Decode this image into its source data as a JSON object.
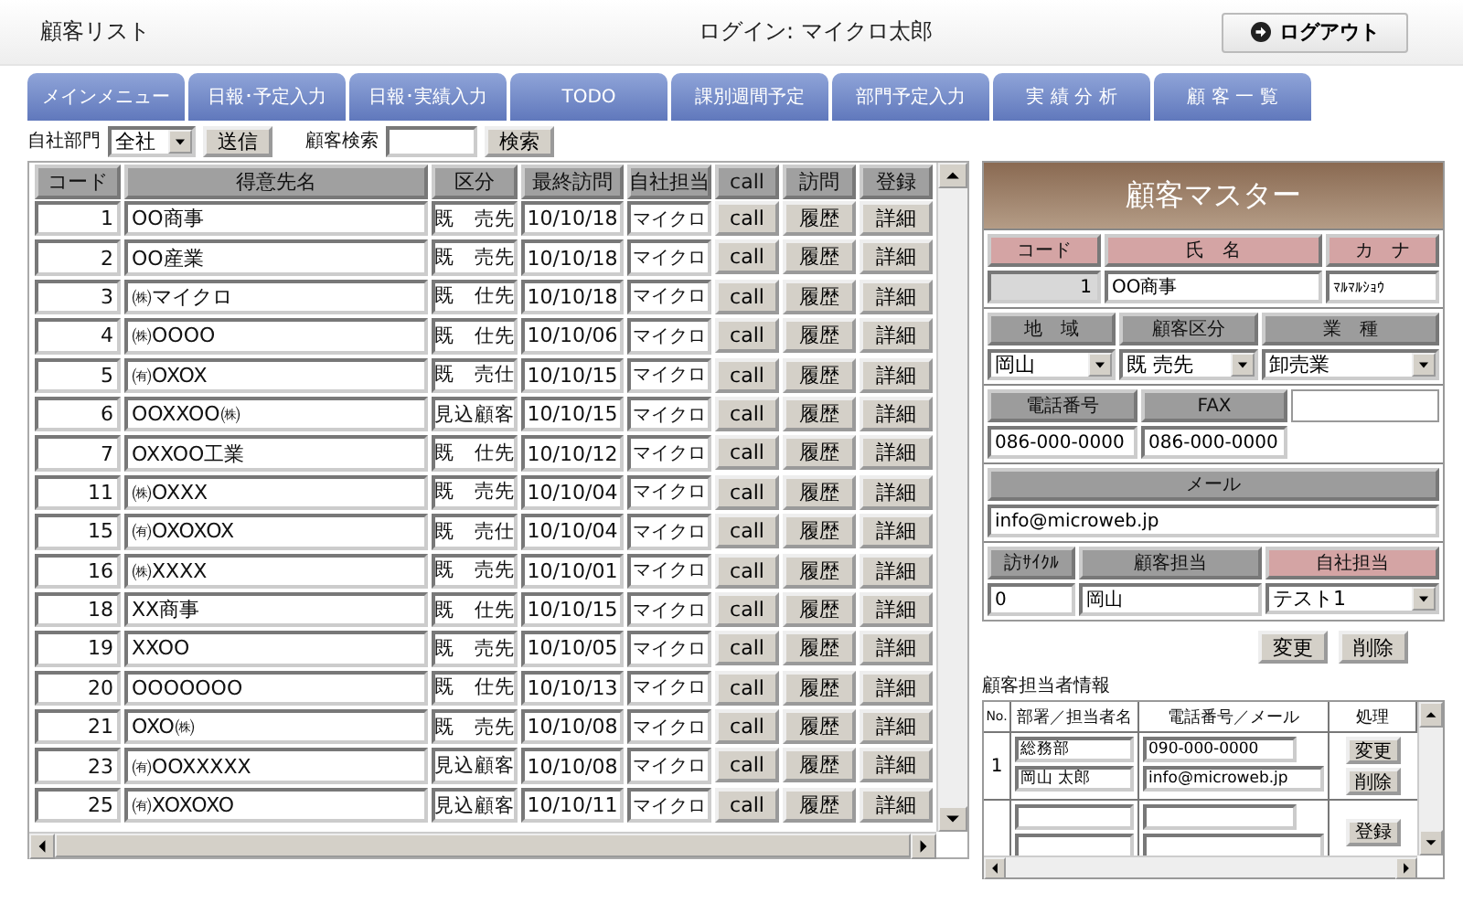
{
  "header": {
    "title": "顧客リスト",
    "login": "ログイン: マイクロ太郎",
    "logout": "ログアウト"
  },
  "tabs": [
    {
      "label": "メインメニュー",
      "selected": false
    },
    {
      "label": "日報･予定入力",
      "selected": false
    },
    {
      "label": "日報･実績入力",
      "selected": false
    },
    {
      "label": "TODO",
      "selected": false
    },
    {
      "label": "課別週間予定",
      "selected": false
    },
    {
      "label": "部門予定入力",
      "selected": false
    },
    {
      "label": "実 績 分 析",
      "selected": false
    },
    {
      "label": "顧 客 一 覧",
      "selected": false
    }
  ],
  "filter": {
    "dept_label": "自社部門",
    "dept_value": "全社",
    "send": "送信",
    "search_label": "顧客検索",
    "search_button": "検索"
  },
  "table": {
    "columns": [
      "コード",
      "得意先名",
      "区分",
      "最終訪問",
      "自社担当",
      "call",
      "訪問",
      "登録"
    ],
    "rows": [
      {
        "code": "1",
        "name": "OO商事",
        "kubun": "既　売先",
        "date": "10/10/18",
        "staff": "マイクロ",
        "call": "call",
        "history": "履歴",
        "detail": "詳細"
      },
      {
        "code": "2",
        "name": "OO産業",
        "kubun": "既　売先",
        "date": "10/10/18",
        "staff": "マイクロ",
        "call": "call",
        "history": "履歴",
        "detail": "詳細"
      },
      {
        "code": "3",
        "name": "㈱マイクロ",
        "kubun": "既　仕先",
        "date": "10/10/18",
        "staff": "マイクロ",
        "call": "call",
        "history": "履歴",
        "detail": "詳細"
      },
      {
        "code": "4",
        "name": "㈱OOOO",
        "kubun": "既　仕先",
        "date": "10/10/06",
        "staff": "マイクロ",
        "call": "call",
        "history": "履歴",
        "detail": "詳細"
      },
      {
        "code": "5",
        "name": "㈲OXOX",
        "kubun": "既　売仕",
        "date": "10/10/15",
        "staff": "マイクロ",
        "call": "call",
        "history": "履歴",
        "detail": "詳細"
      },
      {
        "code": "6",
        "name": "OOXXOO㈱",
        "kubun": "見込顧客",
        "date": "10/10/15",
        "staff": "マイクロ",
        "call": "call",
        "history": "履歴",
        "detail": "詳細"
      },
      {
        "code": "7",
        "name": "OXXOO工業",
        "kubun": "既　仕先",
        "date": "10/10/12",
        "staff": "マイクロ",
        "call": "call",
        "history": "履歴",
        "detail": "詳細"
      },
      {
        "code": "11",
        "name": "㈱OXXX",
        "kubun": "既　売先",
        "date": "10/10/04",
        "staff": "マイクロ",
        "call": "call",
        "history": "履歴",
        "detail": "詳細"
      },
      {
        "code": "15",
        "name": "㈲OXOXOX",
        "kubun": "既　売仕",
        "date": "10/10/04",
        "staff": "マイクロ",
        "call": "call",
        "history": "履歴",
        "detail": "詳細"
      },
      {
        "code": "16",
        "name": "㈱XXXX",
        "kubun": "既　売先",
        "date": "10/10/01",
        "staff": "マイクロ",
        "call": "call",
        "history": "履歴",
        "detail": "詳細"
      },
      {
        "code": "18",
        "name": "XX商事",
        "kubun": "既　仕先",
        "date": "10/10/15",
        "staff": "マイクロ",
        "call": "call",
        "history": "履歴",
        "detail": "詳細"
      },
      {
        "code": "19",
        "name": "XXOO",
        "kubun": "既　売先",
        "date": "10/10/05",
        "staff": "マイクロ",
        "call": "call",
        "history": "履歴",
        "detail": "詳細"
      },
      {
        "code": "20",
        "name": "OOOOOOO",
        "kubun": "既　仕先",
        "date": "10/10/13",
        "staff": "マイクロ",
        "call": "call",
        "history": "履歴",
        "detail": "詳細"
      },
      {
        "code": "21",
        "name": "OXO㈱",
        "kubun": "既　売先",
        "date": "10/10/08",
        "staff": "マイクロ",
        "call": "call",
        "history": "履歴",
        "detail": "詳細"
      },
      {
        "code": "23",
        "name": "㈲OOXXXXX",
        "kubun": "見込顧客",
        "date": "10/10/08",
        "staff": "マイクロ",
        "call": "call",
        "history": "履歴",
        "detail": "詳細"
      },
      {
        "code": "25",
        "name": "㈲XOXOXO",
        "kubun": "見込顧客",
        "date": "10/10/11",
        "staff": "マイクロ",
        "call": "call",
        "history": "履歴",
        "detail": "詳細"
      }
    ]
  },
  "master": {
    "title": "顧客マスター",
    "sections": [
      {
        "labels": [
          {
            "text": "コード",
            "required": true
          },
          {
            "text": "氏　名",
            "required": true
          },
          {
            "text": "カ　ナ",
            "required": true
          }
        ],
        "fields": [
          {
            "kind": "static",
            "value": "1"
          },
          {
            "kind": "input",
            "value": "OO商事"
          },
          {
            "kind": "input",
            "value": "ﾏﾙﾏﾙｼｮｳ"
          }
        ]
      },
      {
        "labels": [
          {
            "text": "地　域",
            "required": false
          },
          {
            "text": "顧客区分",
            "required": false
          },
          {
            "text": "業　種",
            "required": false
          }
        ],
        "fields": [
          {
            "kind": "select",
            "value": "岡山"
          },
          {
            "kind": "select",
            "value": "既 売先"
          },
          {
            "kind": "select",
            "value": "卸売業"
          }
        ]
      },
      {
        "labels": [
          {
            "text": "電話番号",
            "required": false
          },
          {
            "text": "FAX",
            "required": false
          },
          {
            "kind": "blank"
          }
        ],
        "fields": [
          {
            "kind": "input",
            "value": "086-000-0000"
          },
          {
            "kind": "input",
            "value": "086-000-0000"
          }
        ]
      },
      {
        "labels": [
          {
            "text": "メール",
            "required": false
          }
        ],
        "fields": [
          {
            "kind": "input",
            "value": "info@microweb.jp"
          }
        ]
      },
      {
        "labels": [
          {
            "text": "訪ｻｲｸﾙ",
            "required": false
          },
          {
            "text": "顧客担当",
            "required": false
          },
          {
            "text": "自社担当",
            "required": true
          }
        ],
        "fields": [
          {
            "kind": "input",
            "value": "0"
          },
          {
            "kind": "input",
            "value": "岡山"
          },
          {
            "kind": "select",
            "value": "テスト1"
          }
        ]
      }
    ],
    "buttons": [
      "変更",
      "削除"
    ]
  },
  "contacts": {
    "title": "顧客担当者情報",
    "columns": [
      "No.",
      "部署／担当者名",
      "電話番号／メール",
      "処理"
    ],
    "rows": [
      {
        "no": "1",
        "dept": "総務部",
        "person": "岡山 太郎",
        "phone": "090-000-0000",
        "mail": "info@microweb.jp",
        "actions": [
          "変更",
          "削除"
        ]
      },
      {
        "actions": [
          "登録"
        ]
      }
    ]
  }
}
